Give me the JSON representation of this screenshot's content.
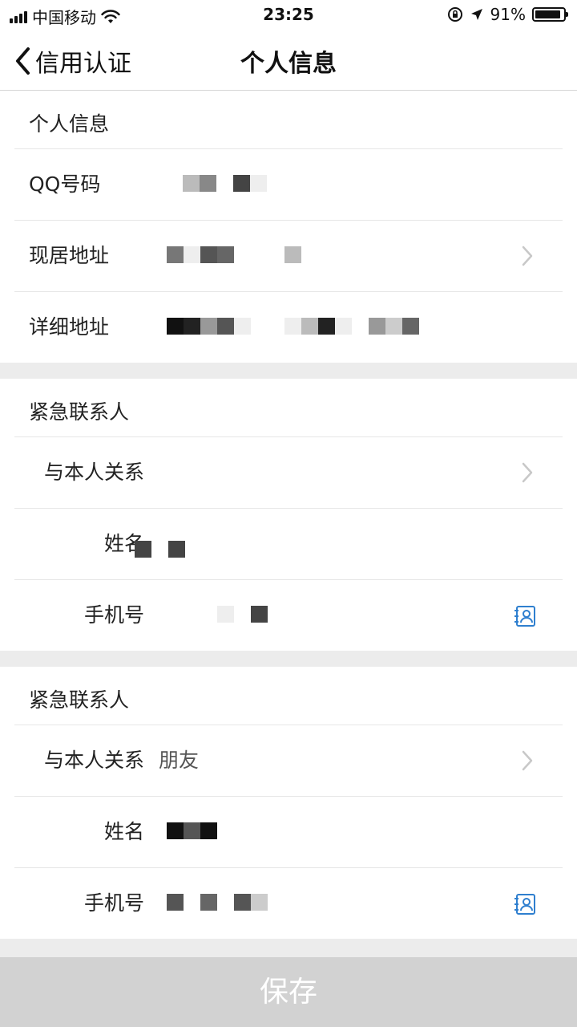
{
  "status_bar": {
    "carrier": "中国移动",
    "time": "23:25",
    "battery": "91%",
    "battery_level": 0.91
  },
  "nav": {
    "back_label": "信用认证",
    "title": "个人信息"
  },
  "personal": {
    "header": "个人信息",
    "qq_label": "QQ号码",
    "address_label": "现居地址",
    "detail_label": "详细地址"
  },
  "contact1": {
    "header": "紧急联系人",
    "relation_label": "与本人关系",
    "name_label": "姓名",
    "phone_label": "手机号"
  },
  "contact2": {
    "header": "紧急联系人",
    "relation_label": "与本人关系",
    "relation_value": "朋友",
    "name_label": "姓名",
    "phone_label": "手机号"
  },
  "save_label": "保存",
  "icons": {
    "back": "chevron-left-icon",
    "chevron": "chevron-right-icon",
    "contact": "contact-book-icon"
  },
  "colors": {
    "contact_icon": "#2f7fcf",
    "save_bar": "#d2d2d2"
  }
}
